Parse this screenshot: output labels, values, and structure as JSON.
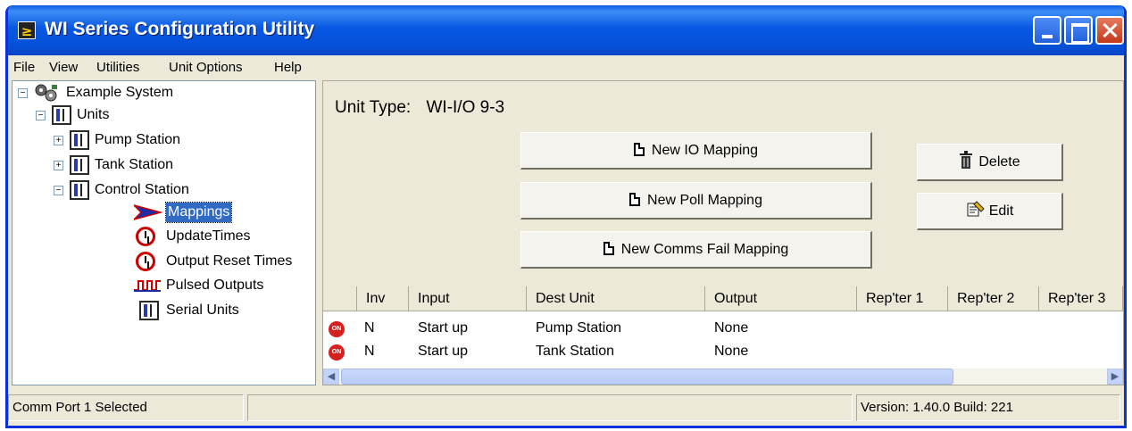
{
  "window": {
    "title": "WI Series Configuration Utility",
    "icon": "app-logo-icon"
  },
  "menu": {
    "file": "File",
    "view": "View",
    "utilities": "Utilities",
    "unit_options": "Unit Options",
    "help": "Help"
  },
  "tree": {
    "root": "Example System",
    "units": "Units",
    "pump_station": "Pump Station",
    "tank_station": "Tank Station",
    "control_station": "Control Station",
    "mappings": "Mappings",
    "update_times": "UpdateTimes",
    "output_reset_times": "Output Reset Times",
    "pulsed_outputs": "Pulsed Outputs",
    "serial_units": "Serial Units"
  },
  "panel": {
    "unit_type_label": "Unit Type:",
    "unit_type_value": "WI-I/O 9-3",
    "new_io_mapping": "New IO Mapping",
    "new_poll_mapping": "New Poll Mapping",
    "new_comms_fail_mapping": "New Comms Fail Mapping",
    "delete": "Delete",
    "edit": "Edit"
  },
  "grid": {
    "columns": [
      "",
      "Inv",
      "Input",
      "Dest Unit",
      "Output",
      "Rep'ter 1",
      "Rep'ter 2",
      "Rep'ter 3"
    ],
    "rows": [
      {
        "icon": "ON",
        "inv": "N",
        "input": "Start up",
        "dest": "Pump Station",
        "output": "None"
      },
      {
        "icon": "ON",
        "inv": "N",
        "input": "Start up",
        "dest": "Tank Station",
        "output": "None"
      }
    ]
  },
  "status": {
    "left": "Comm Port 1 Selected",
    "middle": "",
    "version": "Version: 1.40.0 Build: 221"
  }
}
